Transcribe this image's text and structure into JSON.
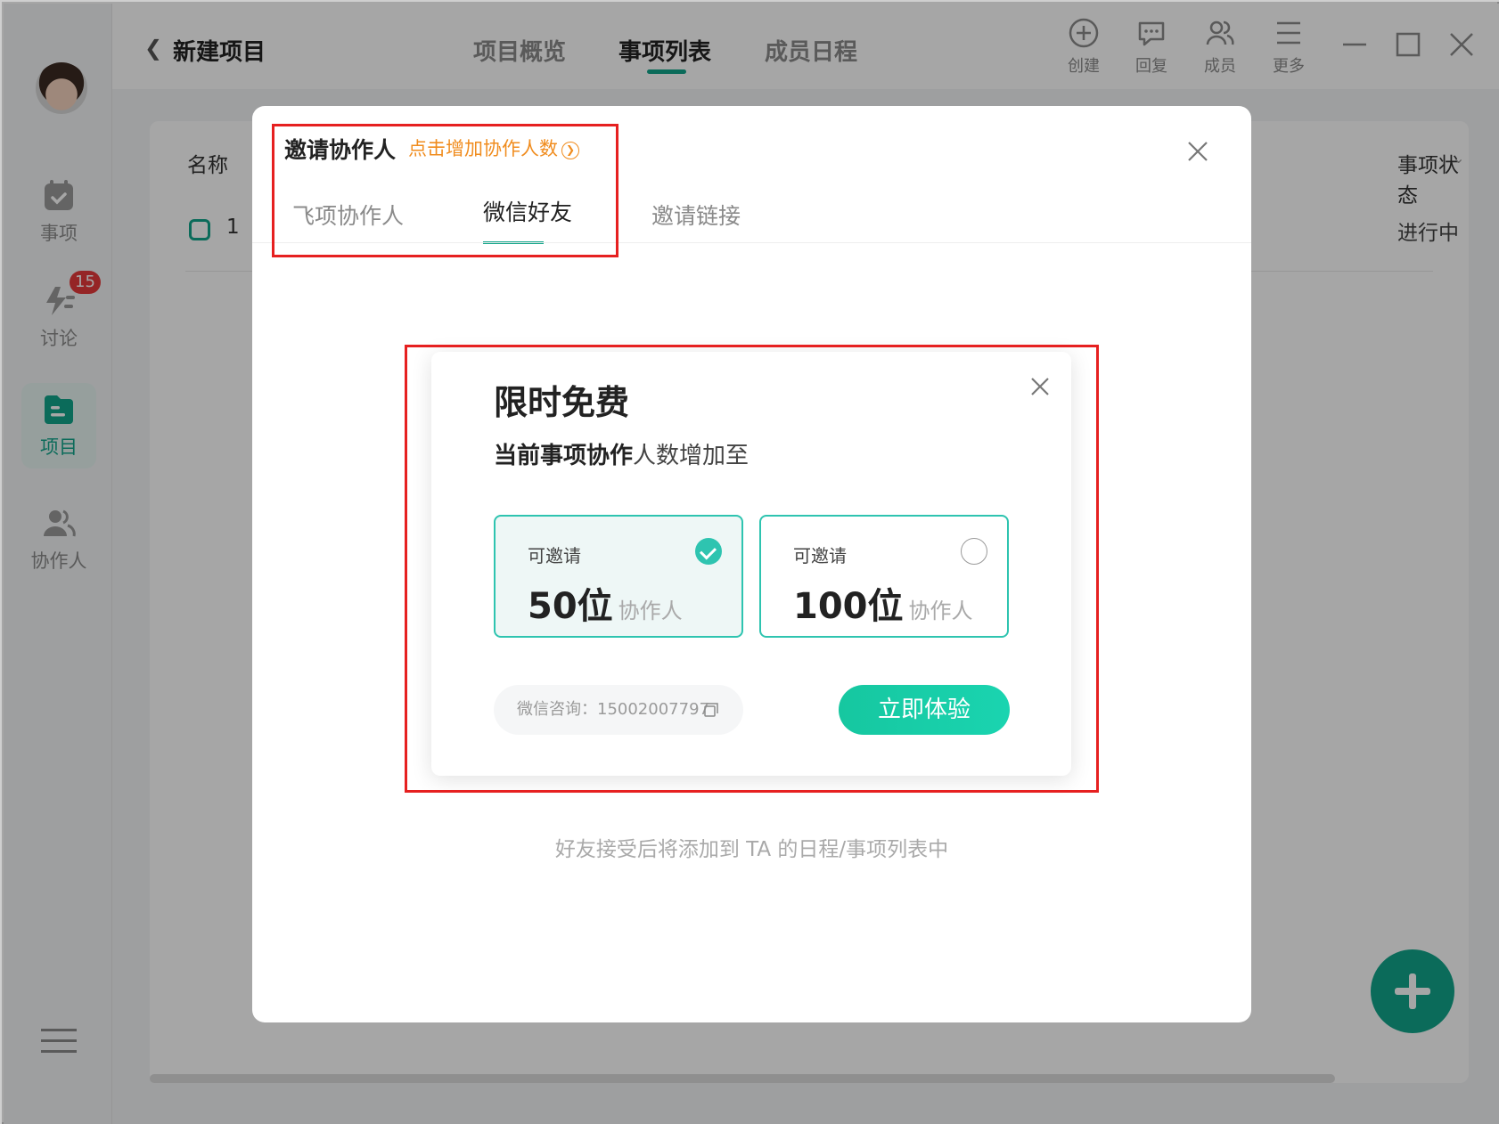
{
  "sidebar": {
    "items": [
      {
        "label": "事项"
      },
      {
        "label": "讨论",
        "badge": "15"
      },
      {
        "label": "项目"
      },
      {
        "label": "协作人"
      }
    ]
  },
  "header": {
    "title": "新建项目",
    "tabs": [
      {
        "label": "项目概览"
      },
      {
        "label": "事项列表"
      },
      {
        "label": "成员日程"
      }
    ],
    "tools": [
      {
        "label": "创建"
      },
      {
        "label": "回复"
      },
      {
        "label": "成员"
      },
      {
        "label": "更多"
      }
    ]
  },
  "list": {
    "col_name": "名称",
    "col_status": "事项状态",
    "row": {
      "num": "1",
      "status": "进行中"
    }
  },
  "dialog": {
    "title": "邀请协作人",
    "hint": "点击增加协作人数",
    "tabs": [
      {
        "label": "飞项协作人"
      },
      {
        "label": "微信好友"
      },
      {
        "label": "邀请链接"
      }
    ],
    "footer": "好友接受后将添加到 TA 的日程/事项列表中"
  },
  "promo": {
    "title": "限时免费",
    "subtitle_bold": "当前事项协作",
    "subtitle_rest": "人数增加至",
    "options": [
      {
        "label": "可邀请",
        "number": "50位",
        "unit": "协作人",
        "selected": true
      },
      {
        "label": "可邀请",
        "number": "100位",
        "unit": "协作人",
        "selected": false
      }
    ],
    "wechat": "微信咨询：15002007797",
    "cta": "立即体验"
  },
  "colors": {
    "accent": "#12a58a",
    "promo_accent": "#2ec4b0",
    "hint": "#f08c1e",
    "badge": "#e5393b",
    "highlight": "#e62020"
  }
}
